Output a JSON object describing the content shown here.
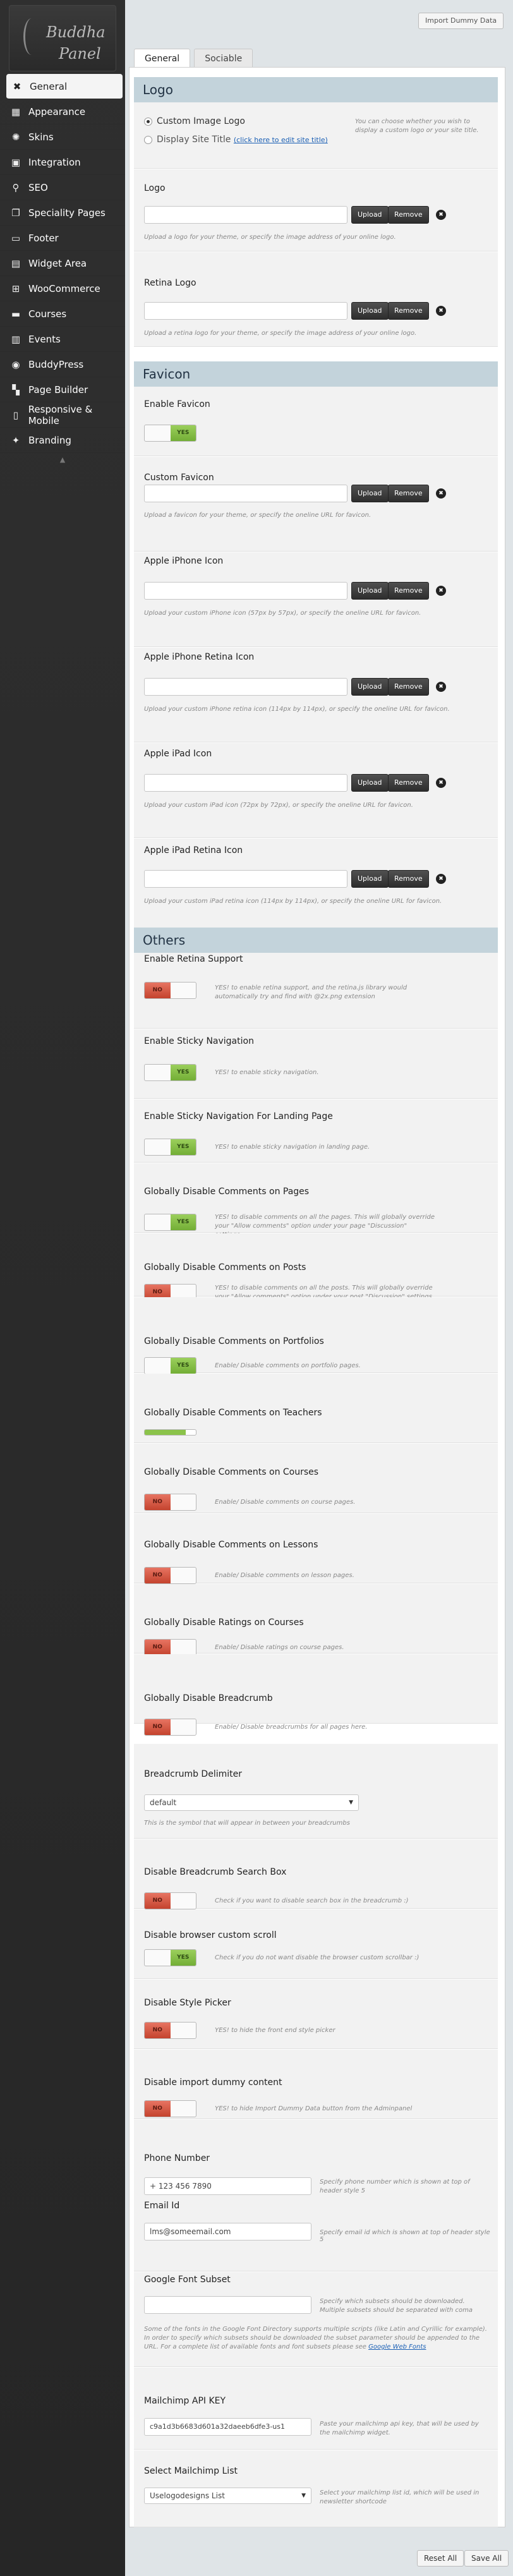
{
  "sidebar": {
    "logo_line1": "Buddha",
    "logo_line2": "Panel",
    "items": [
      {
        "label": "General",
        "icon": "wrench-icon"
      },
      {
        "label": "Appearance",
        "icon": "layout-icon"
      },
      {
        "label": "Skins",
        "icon": "palette-icon"
      },
      {
        "label": "Integration",
        "icon": "code-icon"
      },
      {
        "label": "SEO",
        "icon": "search-icon"
      },
      {
        "label": "Speciality Pages",
        "icon": "pages-icon"
      },
      {
        "label": "Footer",
        "icon": "footer-icon"
      },
      {
        "label": "Widget Area",
        "icon": "widget-icon"
      },
      {
        "label": "WooCommerce",
        "icon": "cart-icon"
      },
      {
        "label": "Courses",
        "icon": "folder-icon"
      },
      {
        "label": "Events",
        "icon": "calendar-icon"
      },
      {
        "label": "BuddyPress",
        "icon": "buddypress-icon"
      },
      {
        "label": "Page Builder",
        "icon": "builder-icon"
      },
      {
        "label": "Responsive & Mobile",
        "icon": "mobile-icon"
      },
      {
        "label": "Branding",
        "icon": "lightbulb-icon"
      }
    ]
  },
  "top": {
    "import_label": "Import Dummy Data"
  },
  "tabs": [
    {
      "label": "General"
    },
    {
      "label": "Sociable"
    }
  ],
  "logo_section": {
    "header": "Logo",
    "custom_image_logo": "Custom Image Logo",
    "display_site_title": "Display Site Title",
    "edit_site_title_link": "(click here to edit site title)",
    "choice_desc": "You can choose whether you wish to display a custom logo or your site title.",
    "logo_label": "Logo",
    "logo_desc": "Upload a logo for your theme, or specify the image address of your online logo.",
    "retina_label": "Retina Logo",
    "retina_desc": "Upload a retina logo for your theme, or specify the image address of your online logo."
  },
  "favicon_section": {
    "header": "Favicon",
    "enable_label": "Enable Favicon",
    "custom_label": "Custom Favicon",
    "custom_desc": "Upload a favicon for your theme, or specify the oneline URL for favicon.",
    "iphone_label": "Apple iPhone Icon",
    "iphone_desc": "Upload your custom iPhone icon (57px by 57px), or specify the oneline URL for favicon.",
    "iphone_retina_label": "Apple iPhone Retina Icon",
    "iphone_retina_desc": "Upload your custom iPhone retina icon (114px by 114px), or specify the oneline URL for favicon.",
    "ipad_label": "Apple iPad Icon",
    "ipad_desc": "Upload your custom iPad icon (72px by 72px), or specify the oneline URL for favicon.",
    "ipad_retina_label": "Apple iPad Retina Icon",
    "ipad_retina_desc": "Upload your custom iPad retina icon (114px by 114px), or specify the oneline URL for favicon."
  },
  "buttons": {
    "upload": "Upload",
    "remove": "Remove",
    "yes": "YES",
    "no": "NO"
  },
  "others_section": {
    "header": "Others",
    "retina_support_label": "Enable Retina Support",
    "retina_support_desc": "YES! to enable retina support, and the retina.js library would automatically try and find with @2x.png extension",
    "sticky_nav_label": "Enable Sticky Navigation",
    "sticky_nav_desc": "YES! to enable sticky navigation.",
    "sticky_landing_label": "Enable Sticky Navigation For Landing Page",
    "sticky_landing_desc": "YES! to enable sticky navigation in landing page.",
    "comments_pages_label": "Globally Disable Comments on Pages",
    "comments_pages_desc": "YES! to disable comments on all the pages. This will globally override your \"Allow comments\" option under your page \"Discussion\" settings.",
    "comments_posts_label": "Globally Disable Comments on Posts",
    "comments_posts_desc": "YES! to disable comments on all the posts. This will globally override your \"Allow comments\" option under your post \"Discussion\" settings.",
    "comments_portfolios_label": "Globally Disable Comments on Portfolios",
    "comments_portfolios_desc": "Enable/ Disable comments on portfolio pages.",
    "comments_teachers_label": "Globally Disable Comments on Teachers",
    "comments_courses_label": "Globally Disable Comments on Courses",
    "comments_courses_desc": "Enable/ Disable comments on course pages.",
    "comments_lessons_label": "Globally Disable Comments on Lessons",
    "comments_lessons_desc": "Enable/ Disable comments on lesson pages.",
    "ratings_courses_label": "Globally Disable Ratings on Courses",
    "ratings_courses_desc": "Enable/ Disable ratings on course pages.",
    "breadcrumb_label": "Globally Disable Breadcrumb",
    "breadcrumb_desc": "Enable/ Disable breadcrumbs for all pages here.",
    "delimiter_label": "Breadcrumb Delimiter",
    "delimiter_value": "default",
    "delimiter_desc": "This is the symbol that will appear in between your breadcrumbs",
    "breadcrumb_search_label": "Disable Breadcrumb Search Box",
    "breadcrumb_search_desc": "Check if you want to disable search box in the breadcrumb :)",
    "custom_scroll_label": "Disable browser custom scroll",
    "custom_scroll_desc": "Check if you do not want disable the browser custom scrollbar :)",
    "style_picker_label": "Disable Style Picker",
    "style_picker_desc": "YES! to hide the front end style picker",
    "import_dummy_label": "Disable import dummy content",
    "import_dummy_desc": "YES! to hide Import Dummy Data button from the Adminpanel",
    "phone_label": "Phone Number",
    "phone_value": "+ 123 456 7890",
    "phone_desc": "Specify phone number which is shown at top of header style 5",
    "email_label": "Email Id",
    "email_value": "lms@someemail.com",
    "email_desc": "Specify email id which is shown at top of header style 5",
    "font_subset_label": "Google Font Subset",
    "font_subset_desc": "Specify which subsets should be downloaded. Multiple subsets should be separated with coma",
    "font_subset_note": "Some of the fonts in the Google Font Directory supports multiple scripts (like Latin and Cyrillic for example). In order to specify which subsets should be downloaded the subset parameter should be appended to the URL. For a complete list of available fonts and font subsets please see",
    "font_subset_link": "Google Web Fonts",
    "mailchimp_label": "Mailchimp API KEY",
    "mailchimp_value": "c9a1d3b6683d601a32daeeb6dfe3-us1",
    "mailchimp_desc": "Paste your mailchimp api key, that will be used by the mailchimp widget.",
    "mailchimp_list_label": "Select Mailchimp List",
    "mailchimp_list_value": "Uselogodesigns List",
    "mailchimp_list_desc": "Select your mailchimp list id, which will be used in newsletter shortcode"
  },
  "footer": {
    "reset_label": "Reset All",
    "save_label": "Save All"
  },
  "toggles": {
    "favicon": "yes",
    "retina_support": "no",
    "sticky_nav": "yes",
    "sticky_landing": "yes",
    "comments_pages": "yes",
    "comments_posts": "no",
    "comments_portfolios": "yes",
    "comments_courses": "no",
    "comments_lessons": "no",
    "ratings_courses": "no",
    "breadcrumb": "no",
    "breadcrumb_search": "no",
    "custom_scroll": "yes",
    "style_picker": "no",
    "import_dummy": "no"
  },
  "colors": {
    "sidebar_bg": "#2b2b2b",
    "section_header_bg": "#c3d3db",
    "toggle_yes": "#8bc34a",
    "toggle_no": "#d9534f"
  }
}
